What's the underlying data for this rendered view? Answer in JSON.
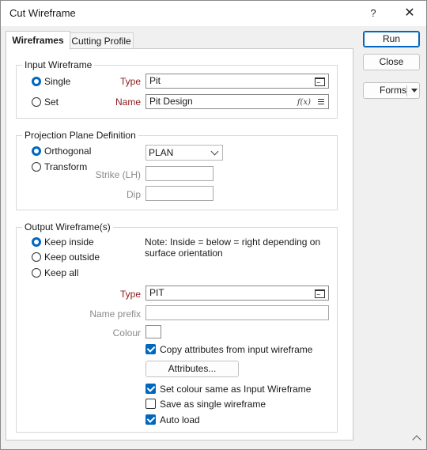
{
  "window": {
    "title": "Cut Wireframe",
    "help_glyph": "?",
    "close_glyph": "✕"
  },
  "tabs": [
    {
      "label": "Wireframes"
    },
    {
      "label": "Cutting Profile"
    }
  ],
  "input_wireframe": {
    "legend": "Input Wireframe",
    "modes": [
      {
        "label": "Single",
        "selected": true
      },
      {
        "label": "Set",
        "selected": false
      }
    ],
    "type_label": "Type",
    "type_value": "Pit",
    "name_label": "Name",
    "name_value": "Pit Design",
    "fx_glyph": "f(x)"
  },
  "projection": {
    "legend": "Projection Plane Definition",
    "modes": [
      {
        "label": "Orthogonal",
        "selected": true
      },
      {
        "label": "Transform",
        "selected": false
      }
    ],
    "plane_value": "PLAN",
    "strike_label": "Strike (LH)",
    "strike_value": "",
    "dip_label": "Dip",
    "dip_value": ""
  },
  "output": {
    "legend": "Output Wireframe(s)",
    "modes": [
      {
        "label": "Keep inside",
        "selected": true
      },
      {
        "label": "Keep outside",
        "selected": false
      },
      {
        "label": "Keep all",
        "selected": false
      }
    ],
    "note": "Note: Inside = below = right depending on surface orientation",
    "type_label": "Type",
    "type_value": "PIT",
    "name_prefix_label": "Name prefix",
    "name_prefix_value": "",
    "colour_label": "Colour",
    "copy_attributes_label": "Copy attributes from input  wireframe",
    "copy_attributes_checked": true,
    "attributes_button": "Attributes...",
    "set_colour_label": "Set colour same as Input Wireframe",
    "set_colour_checked": true,
    "save_single_label": "Save as single wireframe",
    "save_single_checked": false,
    "auto_load_label": "Auto load",
    "auto_load_checked": true
  },
  "actions": {
    "run": "Run",
    "close": "Close",
    "forms": "Forms"
  },
  "colors": {
    "accent": "#0067c0",
    "required_label": "#8b1a1a",
    "disabled_label": "#8a8a8a"
  }
}
